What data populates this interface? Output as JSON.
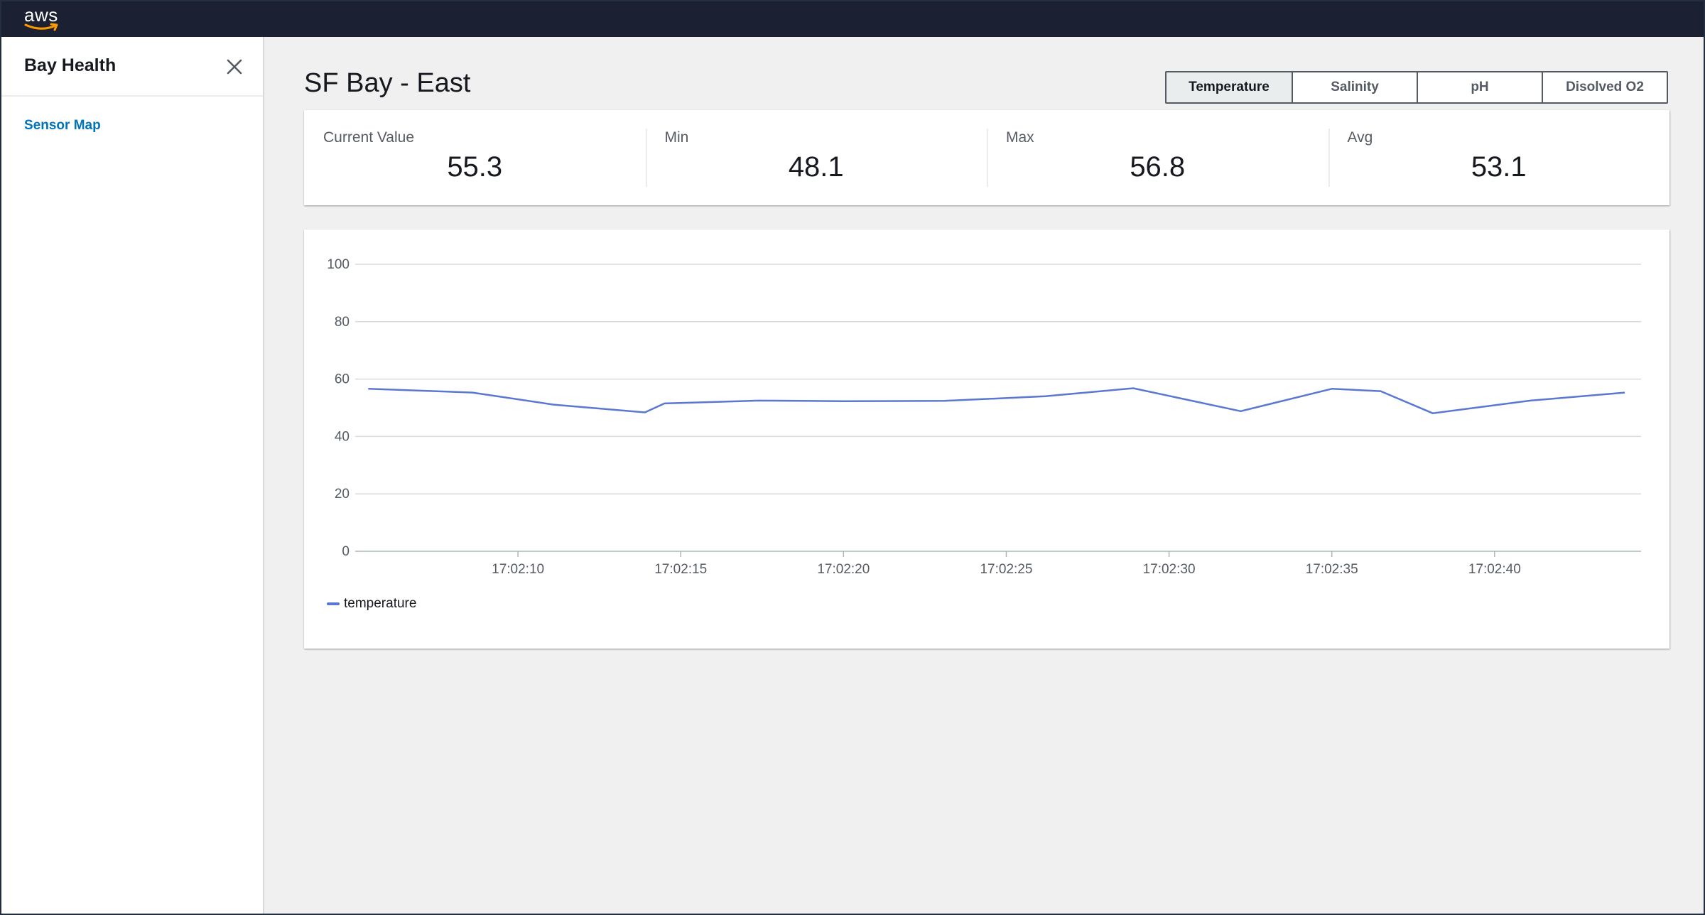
{
  "app": {
    "logo_text": "aws",
    "colors": {
      "topbar": "#1b2132",
      "accent": "#ff9900",
      "link": "#0073bb",
      "series": "#5a78d2"
    }
  },
  "sidebar": {
    "title": "Bay Health",
    "close_icon": "close-icon",
    "items": [
      {
        "label": "Sensor Map"
      }
    ]
  },
  "main": {
    "title": "SF Bay - East",
    "metric_tabs": [
      {
        "label": "Temperature",
        "selected": true
      },
      {
        "label": "Salinity",
        "selected": false
      },
      {
        "label": "pH",
        "selected": false
      },
      {
        "label": "Disolved O2",
        "selected": false
      }
    ],
    "stats": [
      {
        "label": "Current Value",
        "value": "55.3"
      },
      {
        "label": "Min",
        "value": "48.1"
      },
      {
        "label": "Max",
        "value": "56.8"
      },
      {
        "label": "Avg",
        "value": "53.1"
      }
    ]
  },
  "chart_data": {
    "type": "line",
    "ylim": [
      0,
      100
    ],
    "yticks": [
      0,
      20,
      40,
      60,
      80,
      100
    ],
    "xticks": [
      "17:02:10",
      "17:02:15",
      "17:02:20",
      "17:02:25",
      "17:02:30",
      "17:02:35",
      "17:02:40"
    ],
    "grid": true,
    "legend_position": "bottom-left",
    "series": [
      {
        "name": "temperature",
        "color": "#5a78d2",
        "points": [
          {
            "t": 5.4,
            "v": 56.6
          },
          {
            "t": 8.6,
            "v": 55.3
          },
          {
            "t": 11.1,
            "v": 51.1
          },
          {
            "t": 13.9,
            "v": 48.4
          },
          {
            "t": 14.5,
            "v": 51.5
          },
          {
            "t": 17.4,
            "v": 52.5
          },
          {
            "t": 20.0,
            "v": 52.3
          },
          {
            "t": 23.1,
            "v": 52.4
          },
          {
            "t": 26.2,
            "v": 54.0
          },
          {
            "t": 28.9,
            "v": 56.8
          },
          {
            "t": 32.2,
            "v": 48.8
          },
          {
            "t": 35.0,
            "v": 56.6
          },
          {
            "t": 36.5,
            "v": 55.8
          },
          {
            "t": 38.1,
            "v": 48.1
          },
          {
            "t": 41.1,
            "v": 52.5
          },
          {
            "t": 44.0,
            "v": 55.3
          }
        ]
      }
    ]
  }
}
